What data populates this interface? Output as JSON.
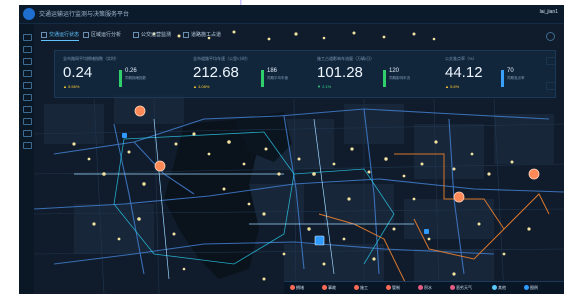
{
  "app": {
    "title": "交通运输运行监测与决策服务平台",
    "user": "lai_jian1",
    "top_mark": "|"
  },
  "tabs": [
    {
      "label": "交通运行状态",
      "active": true
    },
    {
      "label": "区域运行分析",
      "active": false
    },
    {
      "label": "公交运营监测",
      "active": false
    },
    {
      "label": "道路施工占道",
      "active": false
    }
  ],
  "kpis": [
    {
      "label": "全市路网平均拥堵指数（实时）",
      "value": "0.24",
      "sub": "0.26",
      "sub_note": "同期拥堵指数",
      "change": "▲ 5.56%",
      "change_color": "#ffcc33",
      "bar_color": "#2fd06b"
    },
    {
      "label": "全市道路平均车速（公里/小时）",
      "value": "212.68",
      "sub": "186",
      "sub_note": "同期平均车速",
      "change": "▲ 3.08%",
      "change_color": "#ffcc33",
      "bar_color": "#2fd06b"
    },
    {
      "label": "施工占道影响车流量（万辆/日）",
      "value": "101.28",
      "sub": "120",
      "sub_note": "同期影响车流",
      "change": "▼ 2.1%",
      "change_color": "#39d98a",
      "bar_color": "#2fd06b"
    },
    {
      "label": "公交准点率（%）",
      "value": "44.12",
      "sub": "70",
      "sub_note": "同期准点率",
      "change": "▲ 5.6%",
      "change_color": "#ffcc33",
      "bar_color": "#3aa0ff"
    }
  ],
  "toolbar": {
    "items": [
      {
        "label": "拥堵",
        "color": "#ff6b57"
      },
      {
        "label": "事故",
        "color": "#ff6b57"
      },
      {
        "label": "施工",
        "color": "#ff6b57"
      },
      {
        "label": "管制",
        "color": "#ff6b57"
      },
      {
        "label": "积水",
        "color": "#e35d82"
      },
      {
        "label": "恶劣天气",
        "color": "#e35d82"
      },
      {
        "label": "其他",
        "color": "#5ac8fa"
      },
      {
        "label": "图例",
        "color": "#2f9bff"
      }
    ]
  },
  "colors": {
    "accent": "#5ec3ff",
    "panel": "#12283f",
    "road": "#3f78c6",
    "dot": "#f3e3a2"
  }
}
